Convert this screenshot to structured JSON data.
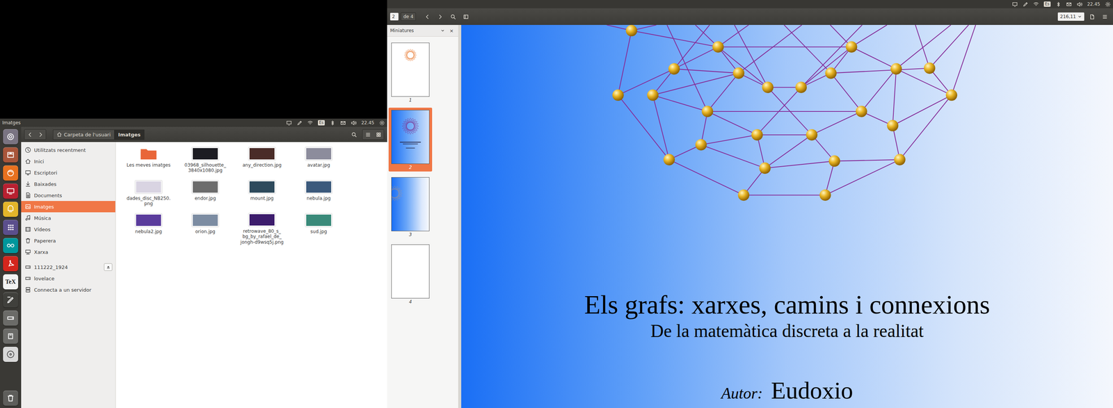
{
  "left_screen": {
    "panel": {
      "title": "Imatges",
      "indicators": [
        {
          "kind": "display"
        },
        {
          "kind": "pen"
        },
        {
          "kind": "wifi"
        },
        {
          "kind": "keyboard",
          "text": "Es"
        },
        {
          "kind": "bluetooth"
        },
        {
          "kind": "mail"
        },
        {
          "kind": "volume"
        },
        {
          "kind": "clock",
          "text": "22.45"
        },
        {
          "kind": "gear"
        }
      ]
    },
    "launcher": [
      {
        "kind": "dash",
        "color": "#7a7482"
      },
      {
        "kind": "files",
        "color": "#a8553a"
      },
      {
        "kind": "firefox",
        "color": "#e8711f"
      },
      {
        "kind": "display",
        "color": "#b82030"
      },
      {
        "kind": "teacher",
        "color": "#e3b52a"
      },
      {
        "kind": "dots",
        "color": "#5b4f8c"
      },
      {
        "kind": "arduino",
        "color": "#00979c"
      },
      {
        "kind": "reader",
        "color": "#d3261d"
      },
      {
        "kind": "tex",
        "color": "#f2f2f2",
        "text": "TeX"
      },
      {
        "kind": "draw",
        "color": "#40403c"
      },
      {
        "kind": "drive",
        "color": "#6b6b68"
      },
      {
        "kind": "removable",
        "color": "#6b6b68"
      },
      {
        "kind": "disc",
        "color": "#d8d8d8"
      },
      {
        "kind": "trash",
        "color": "#5e5e5b"
      }
    ],
    "file_manager": {
      "path": [
        {
          "label": "Carpeta de l'usuari",
          "home": true,
          "selected": false
        },
        {
          "label": "Imatges",
          "home": false,
          "selected": true
        }
      ],
      "sidebar": {
        "places": [
          {
            "label": "Utilitzats recentment",
            "kind": "recent",
            "selected": false
          },
          {
            "label": "Inici",
            "kind": "home",
            "selected": false
          },
          {
            "label": "Escriptori",
            "kind": "desktop",
            "selected": false
          },
          {
            "label": "Baixades",
            "kind": "download",
            "selected": false
          },
          {
            "label": "Documents",
            "kind": "documents",
            "selected": false
          },
          {
            "label": "Imatges",
            "kind": "pictures",
            "selected": true
          },
          {
            "label": "Música",
            "kind": "music",
            "selected": false
          },
          {
            "label": "Vídeos",
            "kind": "videos",
            "selected": false
          },
          {
            "label": "Paperera",
            "kind": "trash",
            "selected": false
          },
          {
            "label": "Xarxa",
            "kind": "network",
            "selected": false
          }
        ],
        "devices": [
          {
            "label": "111222_1924",
            "kind": "drive",
            "selected": false,
            "eject": true
          },
          {
            "label": "lovelace",
            "kind": "drive",
            "selected": false,
            "eject": false
          },
          {
            "label": "Connecta a un servidor",
            "kind": "server",
            "selected": false,
            "eject": false
          }
        ]
      },
      "files": [
        {
          "lines": [
            "Les meves imatges"
          ],
          "kind": "folder",
          "color": "#e8673a"
        },
        {
          "lines": [
            "03968_silhouette_",
            "3840x1080.jpg"
          ],
          "kind": "image",
          "color": "#1c1c22"
        },
        {
          "lines": [
            "any_direction.jpg"
          ],
          "kind": "image",
          "color": "#4a2c28"
        },
        {
          "lines": [
            "avatar.jpg"
          ],
          "kind": "image",
          "color": "#8c8c9c"
        },
        {
          "lines": [
            "dades_disc_NB250.",
            "png"
          ],
          "kind": "image",
          "color": "#d9d4e2"
        },
        {
          "lines": [
            "endor.jpg"
          ],
          "kind": "image",
          "color": "#6c6c6c"
        },
        {
          "lines": [
            "mount.jpg"
          ],
          "kind": "image",
          "color": "#2e4a5c"
        },
        {
          "lines": [
            "nebula.jpg"
          ],
          "kind": "image",
          "color": "#3c5a7c"
        },
        {
          "lines": [
            "nebula2.jpg"
          ],
          "kind": "image",
          "color": "#5a3c9c"
        },
        {
          "lines": [
            "orion.jpg"
          ],
          "kind": "image",
          "color": "#7c8ca2"
        },
        {
          "lines": [
            "retrowave_80_s_",
            "bg_by_rafael_de_",
            "jongh-d9wsq5j.png"
          ],
          "kind": "image",
          "color": "#3c1c6c"
        },
        {
          "lines": [
            "sud.jpg"
          ],
          "kind": "image",
          "color": "#3a8a7a"
        }
      ]
    }
  },
  "right_screen": {
    "panel": {
      "indicators": [
        {
          "kind": "display"
        },
        {
          "kind": "pen"
        },
        {
          "kind": "wifi"
        },
        {
          "kind": "keyboard",
          "text": "Es"
        },
        {
          "kind": "bluetooth"
        },
        {
          "kind": "mail"
        },
        {
          "kind": "volume"
        },
        {
          "kind": "clock",
          "text": "22.45"
        },
        {
          "kind": "gear"
        }
      ]
    },
    "viewer": {
      "page": "2",
      "of": "de 4",
      "zoom": "216,11",
      "sidebar": {
        "title": "Miniatures",
        "close": "×",
        "pages": [
          {
            "label": "1",
            "selected": false,
            "kind": "title-white"
          },
          {
            "label": "2",
            "selected": true,
            "kind": "title-blue"
          },
          {
            "label": "3",
            "selected": false,
            "kind": "gradient"
          },
          {
            "label": "4",
            "selected": false,
            "kind": "blank"
          }
        ]
      },
      "figure": {
        "kind": "graph",
        "nodes": 25
      },
      "document": {
        "title": "Els grafs: xarxes, camins i connexions",
        "subtitle": "De la matemàtica discreta a la realitat",
        "author_label": "Autor:",
        "author": "Eudoxio"
      }
    }
  }
}
